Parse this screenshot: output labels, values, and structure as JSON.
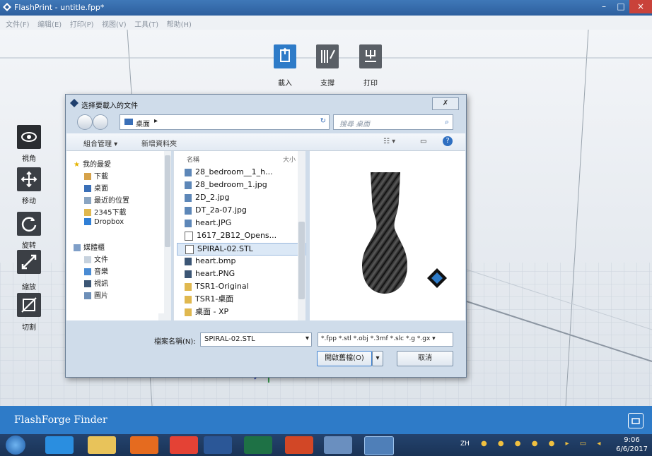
{
  "window": {
    "title": "FlashPrint - untitle.fpp*",
    "minimize": "–",
    "maximize": "□",
    "close": "×"
  },
  "menubar": {
    "items": [
      "文件(F)",
      "编辑(E)",
      "打印(P)",
      "视图(V)",
      "工具(T)",
      "帮助(H)"
    ]
  },
  "toolbar": {
    "load_label": "載入",
    "support_label": "支撐",
    "print_label": "打印"
  },
  "lefttools": {
    "view_label": "視角",
    "move_label": "移动",
    "rotate_label": "旋转",
    "scale_label": "縮放",
    "cut_label": "切割"
  },
  "dialog": {
    "title": "选择要載入的文件",
    "close": "✗",
    "address": "桌面",
    "search_placeholder": "搜尋 桌面",
    "organize": "組合管理 ▾",
    "new_folder": "新增資料夾",
    "nav": {
      "favorites": "我的最愛",
      "fav_items": [
        "下載",
        "桌面",
        "最近的位置",
        "2345下載",
        "Dropbox"
      ],
      "libraries": "媒體櫃",
      "lib_items": [
        "文件",
        "音樂",
        "視訊",
        "圖片"
      ]
    },
    "columns": {
      "name": "名稱",
      "size": "大小"
    },
    "files": [
      "28_bedroom__1_h...",
      "28_bedroom_1.jpg",
      "2D_2.jpg",
      "DT_2a-07.jpg",
      "heart.JPG",
      "1617_2B12_Opens...",
      "SPIRAL-02.STL",
      "heart.bmp",
      "heart.PNG",
      "TSR1-Original",
      "TSR1-桌面",
      "桌面 - XP"
    ],
    "selected_file": "SPIRAL-02.STL",
    "filename_label": "檔案名稱(N):",
    "filename_value": "SPIRAL-02.STL",
    "filter_value": "*.fpp *.stl *.obj *.3mf *.slc *.g *.gx ▾",
    "open_button": "開啟舊檔(O)",
    "cancel_button": "取消"
  },
  "appbar": {
    "name": "FlashForge Finder"
  },
  "taskbar": {
    "lang": "ZH",
    "time": "9:06",
    "date": "6/6/2017"
  },
  "colors": {
    "accent": "#2e7bc8",
    "tool_dark": "#3b3f45",
    "title_blue": "#2d5f9e"
  }
}
